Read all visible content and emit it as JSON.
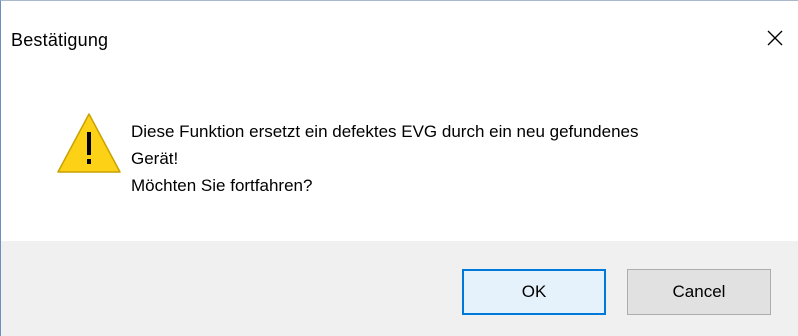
{
  "dialog": {
    "title": "Bestätigung",
    "close_icon": "close-icon",
    "icon": "warning-icon",
    "message_lines": [
      "Diese Funktion ersetzt ein defektes EVG durch ein neu gefundenes",
      "Gerät!",
      "Möchten Sie fortfahren?"
    ],
    "buttons": {
      "ok_label": "OK",
      "cancel_label": "Cancel"
    },
    "colors": {
      "accent": "#0078d7",
      "warning_fill": "#fcd116",
      "footer_bg": "#f0f0f0"
    }
  }
}
